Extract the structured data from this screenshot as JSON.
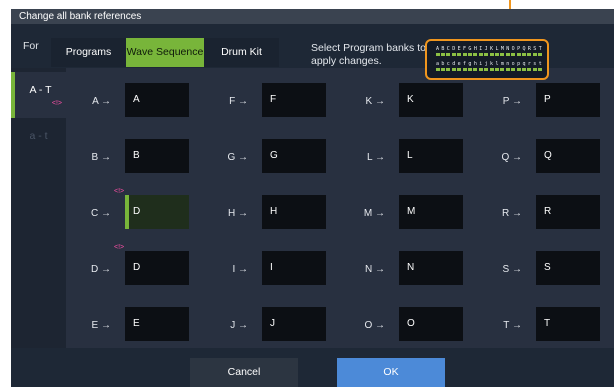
{
  "window": {
    "title": "Change all bank references"
  },
  "header": {
    "for_label": "For",
    "tabs": [
      {
        "label": "Programs",
        "active": false
      },
      {
        "label": "Wave Sequence",
        "active": true
      },
      {
        "label": "Drum Kit",
        "active": false
      }
    ],
    "bank_prompt": "Select Program banks to apply changes.",
    "bank_rows": [
      [
        "A",
        "B",
        "C",
        "D",
        "E",
        "F",
        "G",
        "H",
        "I",
        "J",
        "K",
        "L",
        "M",
        "N",
        "O",
        "P",
        "Q",
        "R",
        "S",
        "T"
      ],
      [
        "a",
        "b",
        "c",
        "d",
        "e",
        "f",
        "g",
        "h",
        "i",
        "j",
        "k",
        "l",
        "m",
        "n",
        "o",
        "p",
        "q",
        "r",
        "s",
        "t"
      ]
    ]
  },
  "sidebar": {
    "ranges": [
      {
        "label": "A - T",
        "active": true,
        "marker": "<!>"
      },
      {
        "label": "a - t",
        "active": false
      }
    ]
  },
  "mappings": [
    {
      "label": "A →",
      "value": "A"
    },
    {
      "label": "B →",
      "value": "B"
    },
    {
      "label": "C →",
      "value": "D",
      "modified": "<!>",
      "selected": true
    },
    {
      "label": "D →",
      "value": "D",
      "modified": "<!>"
    },
    {
      "label": "E →",
      "value": "E"
    },
    {
      "label": "F →",
      "value": "F"
    },
    {
      "label": "G →",
      "value": "G"
    },
    {
      "label": "H →",
      "value": "H"
    },
    {
      "label": "I →",
      "value": "I"
    },
    {
      "label": "J →",
      "value": "J"
    },
    {
      "label": "K →",
      "value": "K"
    },
    {
      "label": "L →",
      "value": "L"
    },
    {
      "label": "M →",
      "value": "M"
    },
    {
      "label": "N →",
      "value": "N"
    },
    {
      "label": "O →",
      "value": "O"
    },
    {
      "label": "P →",
      "value": "P"
    },
    {
      "label": "Q →",
      "value": "Q"
    },
    {
      "label": "R →",
      "value": "R"
    },
    {
      "label": "S →",
      "value": "S"
    },
    {
      "label": "T →",
      "value": "T"
    }
  ],
  "footer": {
    "cancel_label": "Cancel",
    "ok_label": "OK"
  },
  "colors": {
    "accent_green": "#78b53a",
    "highlight_orange": "#f0961e",
    "ok_blue": "#4c8ad8",
    "marker_pink": "#ff50a8"
  }
}
